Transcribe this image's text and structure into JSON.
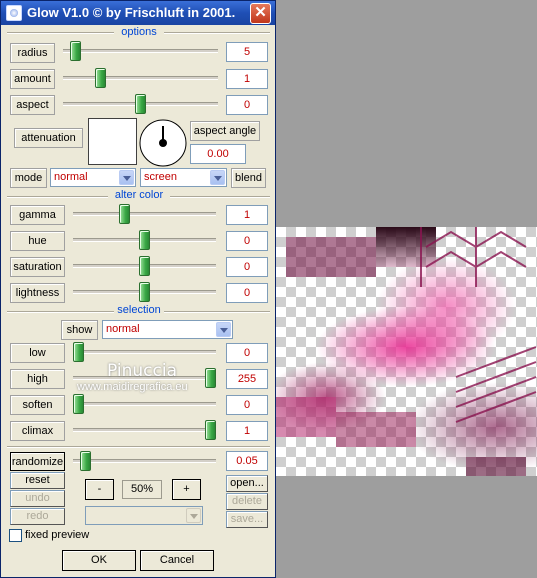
{
  "window": {
    "title": "Glow V1.0 © by Frischluft in 2001.",
    "close_glyph": "✕"
  },
  "sections": {
    "options": "options",
    "alter_color": "alter color",
    "selection": "selection"
  },
  "options": {
    "sliders": [
      {
        "label": "radius",
        "value": "5",
        "level": 0.05
      },
      {
        "label": "amount",
        "value": "1",
        "level": 0.22
      },
      {
        "label": "aspect",
        "value": "0",
        "level": 0.5
      }
    ],
    "attenuation_label": "attenuation",
    "aspect_angle_label": "aspect angle",
    "aspect_angle_value": "0.00",
    "mode_label": "mode",
    "mode_value": "normal",
    "blend_value": "screen",
    "blend_label": "blend"
  },
  "alter_color": {
    "sliders": [
      {
        "label": "gamma",
        "value": "1",
        "level": 0.35
      },
      {
        "label": "hue",
        "value": "0",
        "level": 0.5
      },
      {
        "label": "saturation",
        "value": "0",
        "level": 0.5
      },
      {
        "label": "lightness",
        "value": "0",
        "level": 0.5
      }
    ]
  },
  "selection": {
    "show_label": "show",
    "show_value": "normal",
    "sliders": [
      {
        "label": "low",
        "value": "0",
        "level": 0.0
      },
      {
        "label": "high",
        "value": "255",
        "level": 1.0
      },
      {
        "label": "soften",
        "value": "0",
        "level": 0.0
      },
      {
        "label": "climax",
        "value": "1",
        "level": 1.0
      }
    ]
  },
  "controls": {
    "randomize_label": "randomize",
    "randomize_value": "0.05",
    "randomize_level": 0.05,
    "reset_label": "reset",
    "undo_label": "undo",
    "redo_label": "redo",
    "zoom_out_label": "-",
    "zoom_value": "50%",
    "zoom_in_label": "+",
    "open_label": "open...",
    "delete_label": "delete",
    "save_label": "save...",
    "fixed_preview_label": "fixed preview",
    "fixed_preview_checked": false,
    "ok_label": "OK",
    "cancel_label": "Cancel"
  },
  "watermark": {
    "name": "Pinuccia",
    "url": "www.maidiregrafica.eu"
  },
  "colors": {
    "title_bar": "#1f4fb5",
    "value_text": "#c00000",
    "section_heading": "#0046d5",
    "thumb": "#3aa845",
    "preview_magenta": "#e8278f"
  }
}
